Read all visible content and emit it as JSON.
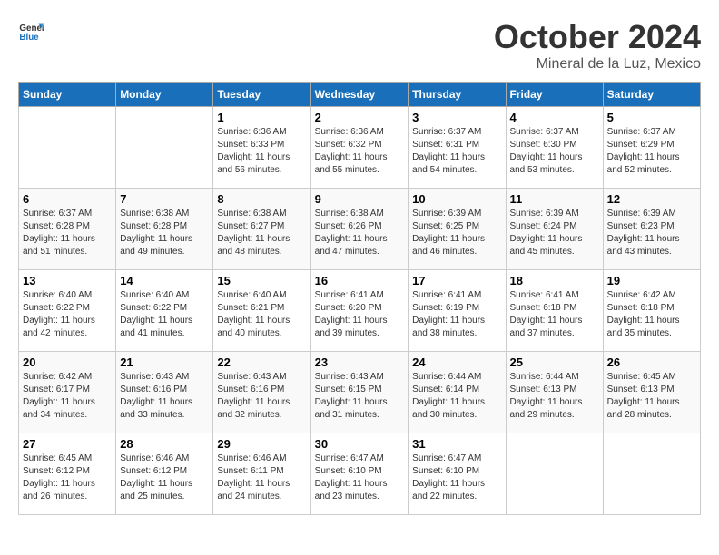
{
  "logo": {
    "general": "General",
    "blue": "Blue"
  },
  "title": "October 2024",
  "location": "Mineral de la Luz, Mexico",
  "weekdays": [
    "Sunday",
    "Monday",
    "Tuesday",
    "Wednesday",
    "Thursday",
    "Friday",
    "Saturday"
  ],
  "weeks": [
    [
      {
        "day": "",
        "info": ""
      },
      {
        "day": "",
        "info": ""
      },
      {
        "day": "1",
        "info": "Sunrise: 6:36 AM\nSunset: 6:33 PM\nDaylight: 11 hours and 56 minutes."
      },
      {
        "day": "2",
        "info": "Sunrise: 6:36 AM\nSunset: 6:32 PM\nDaylight: 11 hours and 55 minutes."
      },
      {
        "day": "3",
        "info": "Sunrise: 6:37 AM\nSunset: 6:31 PM\nDaylight: 11 hours and 54 minutes."
      },
      {
        "day": "4",
        "info": "Sunrise: 6:37 AM\nSunset: 6:30 PM\nDaylight: 11 hours and 53 minutes."
      },
      {
        "day": "5",
        "info": "Sunrise: 6:37 AM\nSunset: 6:29 PM\nDaylight: 11 hours and 52 minutes."
      }
    ],
    [
      {
        "day": "6",
        "info": "Sunrise: 6:37 AM\nSunset: 6:28 PM\nDaylight: 11 hours and 51 minutes."
      },
      {
        "day": "7",
        "info": "Sunrise: 6:38 AM\nSunset: 6:28 PM\nDaylight: 11 hours and 49 minutes."
      },
      {
        "day": "8",
        "info": "Sunrise: 6:38 AM\nSunset: 6:27 PM\nDaylight: 11 hours and 48 minutes."
      },
      {
        "day": "9",
        "info": "Sunrise: 6:38 AM\nSunset: 6:26 PM\nDaylight: 11 hours and 47 minutes."
      },
      {
        "day": "10",
        "info": "Sunrise: 6:39 AM\nSunset: 6:25 PM\nDaylight: 11 hours and 46 minutes."
      },
      {
        "day": "11",
        "info": "Sunrise: 6:39 AM\nSunset: 6:24 PM\nDaylight: 11 hours and 45 minutes."
      },
      {
        "day": "12",
        "info": "Sunrise: 6:39 AM\nSunset: 6:23 PM\nDaylight: 11 hours and 43 minutes."
      }
    ],
    [
      {
        "day": "13",
        "info": "Sunrise: 6:40 AM\nSunset: 6:22 PM\nDaylight: 11 hours and 42 minutes."
      },
      {
        "day": "14",
        "info": "Sunrise: 6:40 AM\nSunset: 6:22 PM\nDaylight: 11 hours and 41 minutes."
      },
      {
        "day": "15",
        "info": "Sunrise: 6:40 AM\nSunset: 6:21 PM\nDaylight: 11 hours and 40 minutes."
      },
      {
        "day": "16",
        "info": "Sunrise: 6:41 AM\nSunset: 6:20 PM\nDaylight: 11 hours and 39 minutes."
      },
      {
        "day": "17",
        "info": "Sunrise: 6:41 AM\nSunset: 6:19 PM\nDaylight: 11 hours and 38 minutes."
      },
      {
        "day": "18",
        "info": "Sunrise: 6:41 AM\nSunset: 6:18 PM\nDaylight: 11 hours and 37 minutes."
      },
      {
        "day": "19",
        "info": "Sunrise: 6:42 AM\nSunset: 6:18 PM\nDaylight: 11 hours and 35 minutes."
      }
    ],
    [
      {
        "day": "20",
        "info": "Sunrise: 6:42 AM\nSunset: 6:17 PM\nDaylight: 11 hours and 34 minutes."
      },
      {
        "day": "21",
        "info": "Sunrise: 6:43 AM\nSunset: 6:16 PM\nDaylight: 11 hours and 33 minutes."
      },
      {
        "day": "22",
        "info": "Sunrise: 6:43 AM\nSunset: 6:16 PM\nDaylight: 11 hours and 32 minutes."
      },
      {
        "day": "23",
        "info": "Sunrise: 6:43 AM\nSunset: 6:15 PM\nDaylight: 11 hours and 31 minutes."
      },
      {
        "day": "24",
        "info": "Sunrise: 6:44 AM\nSunset: 6:14 PM\nDaylight: 11 hours and 30 minutes."
      },
      {
        "day": "25",
        "info": "Sunrise: 6:44 AM\nSunset: 6:13 PM\nDaylight: 11 hours and 29 minutes."
      },
      {
        "day": "26",
        "info": "Sunrise: 6:45 AM\nSunset: 6:13 PM\nDaylight: 11 hours and 28 minutes."
      }
    ],
    [
      {
        "day": "27",
        "info": "Sunrise: 6:45 AM\nSunset: 6:12 PM\nDaylight: 11 hours and 26 minutes."
      },
      {
        "day": "28",
        "info": "Sunrise: 6:46 AM\nSunset: 6:12 PM\nDaylight: 11 hours and 25 minutes."
      },
      {
        "day": "29",
        "info": "Sunrise: 6:46 AM\nSunset: 6:11 PM\nDaylight: 11 hours and 24 minutes."
      },
      {
        "day": "30",
        "info": "Sunrise: 6:47 AM\nSunset: 6:10 PM\nDaylight: 11 hours and 23 minutes."
      },
      {
        "day": "31",
        "info": "Sunrise: 6:47 AM\nSunset: 6:10 PM\nDaylight: 11 hours and 22 minutes."
      },
      {
        "day": "",
        "info": ""
      },
      {
        "day": "",
        "info": ""
      }
    ]
  ]
}
